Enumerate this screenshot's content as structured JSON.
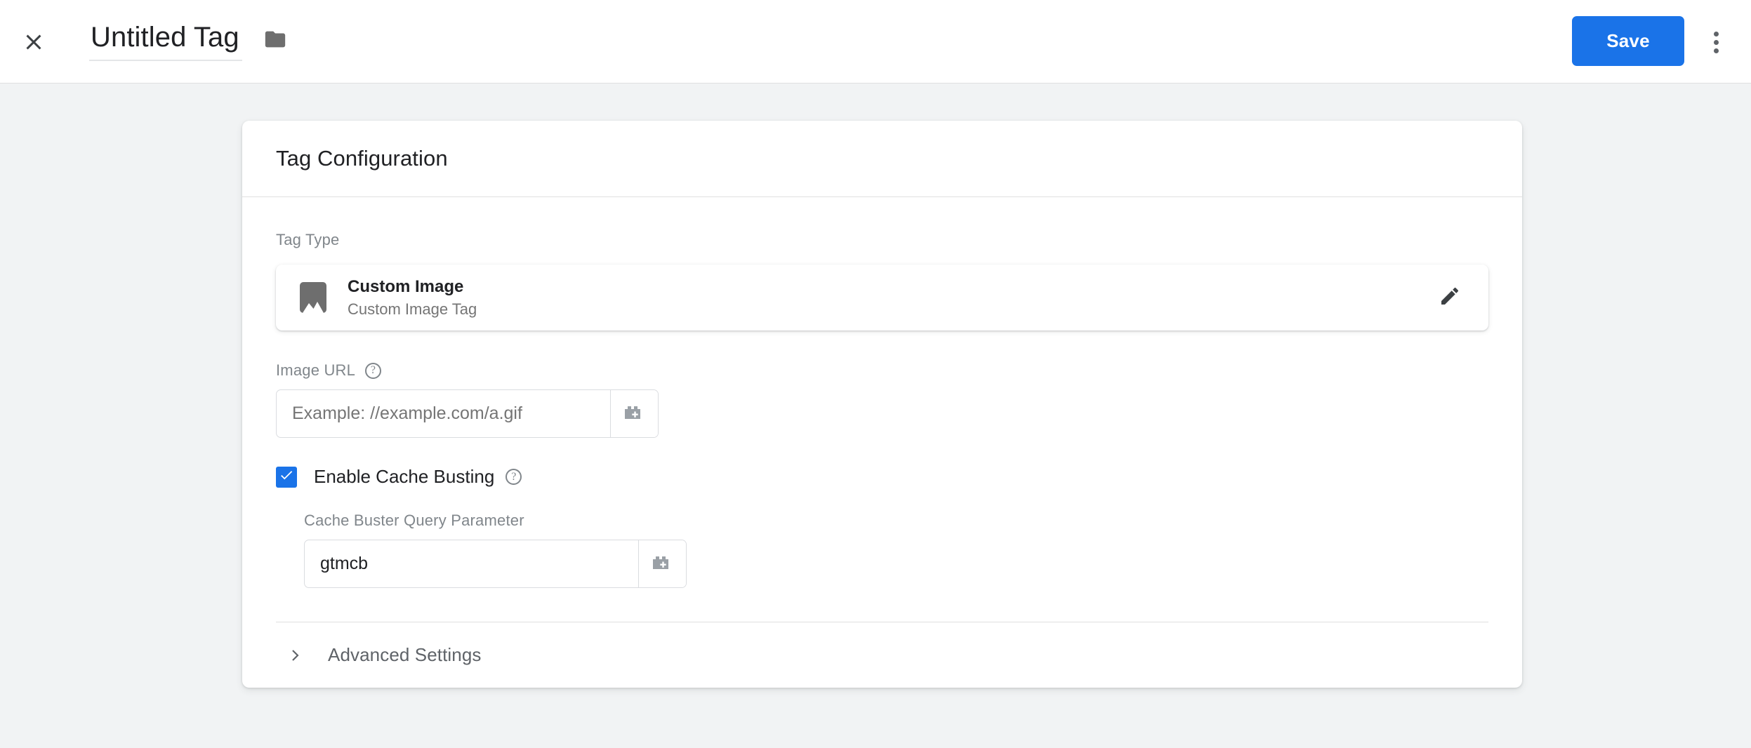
{
  "topbar": {
    "close_icon": "close-icon",
    "title": "Untitled Tag",
    "folder_icon": "folder-icon",
    "save_label": "Save",
    "more_icon": "more-vert-icon"
  },
  "card": {
    "header_title": "Tag Configuration",
    "tag_type": {
      "label": "Tag Type",
      "icon": "image-icon",
      "name": "Custom Image",
      "description": "Custom Image Tag",
      "edit_icon": "pencil-icon"
    },
    "image_url": {
      "label": "Image URL",
      "help_icon": "help-circle-icon",
      "value": "",
      "placeholder": "Example: //example.com/a.gif",
      "variable_icon": "add-variable-icon"
    },
    "cache_busting": {
      "checkbox_icon": "checkmark-icon",
      "checked": true,
      "label": "Enable Cache Busting",
      "help_icon": "help-circle-icon",
      "param_label": "Cache Buster Query Parameter",
      "param_value": "gtmcb",
      "param_placeholder": "",
      "variable_icon": "add-variable-icon"
    },
    "advanced": {
      "chevron_icon": "chevron-right-icon",
      "label": "Advanced Settings"
    }
  },
  "colors": {
    "accent": "#1a73e8",
    "page_bg": "#f1f3f4",
    "card_bg": "#ffffff",
    "text_primary": "#202124",
    "text_secondary": "#80868b",
    "border": "#dadce0"
  }
}
